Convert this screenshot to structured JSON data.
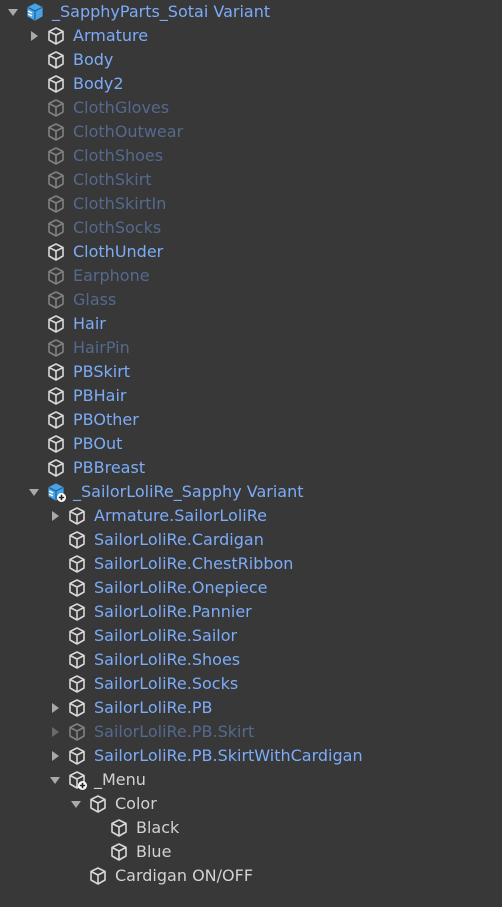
{
  "colors": {
    "background": "#383838",
    "prefab_text": "#7cacf8",
    "object_text": "#d2d2d2",
    "inactive_text": "#55698f",
    "prefab_root_icon": "#4aa3e6"
  },
  "hierarchy": {
    "rows": [
      {
        "label": "_SapphyParts_Sotai Variant",
        "depth": 0,
        "arrow": "down",
        "icon": "prefab-variant-root-icon",
        "style": "blue"
      },
      {
        "label": "Armature",
        "depth": 1,
        "arrow": "right",
        "icon": "cube-icon",
        "style": "blue"
      },
      {
        "label": "Body",
        "depth": 1,
        "arrow": "",
        "icon": "cube-icon",
        "style": "blue"
      },
      {
        "label": "Body2",
        "depth": 1,
        "arrow": "",
        "icon": "cube-icon",
        "style": "blue"
      },
      {
        "label": "ClothGloves",
        "depth": 1,
        "arrow": "",
        "icon": "cube-icon",
        "style": "dim"
      },
      {
        "label": "ClothOutwear",
        "depth": 1,
        "arrow": "",
        "icon": "cube-icon",
        "style": "dim"
      },
      {
        "label": "ClothShoes",
        "depth": 1,
        "arrow": "",
        "icon": "cube-icon",
        "style": "dim"
      },
      {
        "label": "ClothSkirt",
        "depth": 1,
        "arrow": "",
        "icon": "cube-icon",
        "style": "dim"
      },
      {
        "label": "ClothSkirtIn",
        "depth": 1,
        "arrow": "",
        "icon": "cube-icon",
        "style": "dim"
      },
      {
        "label": "ClothSocks",
        "depth": 1,
        "arrow": "",
        "icon": "cube-icon",
        "style": "dim"
      },
      {
        "label": "ClothUnder",
        "depth": 1,
        "arrow": "",
        "icon": "cube-icon",
        "style": "blue"
      },
      {
        "label": "Earphone",
        "depth": 1,
        "arrow": "",
        "icon": "cube-icon",
        "style": "dim"
      },
      {
        "label": "Glass",
        "depth": 1,
        "arrow": "",
        "icon": "cube-icon",
        "style": "dim"
      },
      {
        "label": "Hair",
        "depth": 1,
        "arrow": "",
        "icon": "cube-icon",
        "style": "blue"
      },
      {
        "label": "HairPin",
        "depth": 1,
        "arrow": "",
        "icon": "cube-icon",
        "style": "dim"
      },
      {
        "label": "PBSkirt",
        "depth": 1,
        "arrow": "",
        "icon": "cube-icon",
        "style": "blue"
      },
      {
        "label": "PBHair",
        "depth": 1,
        "arrow": "",
        "icon": "cube-icon",
        "style": "blue"
      },
      {
        "label": "PBOther",
        "depth": 1,
        "arrow": "",
        "icon": "cube-icon",
        "style": "blue"
      },
      {
        "label": "PBOut",
        "depth": 1,
        "arrow": "",
        "icon": "cube-icon",
        "style": "blue"
      },
      {
        "label": "PBBreast",
        "depth": 1,
        "arrow": "",
        "icon": "cube-icon",
        "style": "blue"
      },
      {
        "label": "_SailorLoliRe_Sapphy Variant",
        "depth": 1,
        "arrow": "down",
        "icon": "prefab-variant-added-icon",
        "style": "blue"
      },
      {
        "label": "Armature.SailorLoliRe",
        "depth": 2,
        "arrow": "right",
        "icon": "cube-icon",
        "style": "blue"
      },
      {
        "label": "SailorLoliRe.Cardigan",
        "depth": 2,
        "arrow": "",
        "icon": "cube-icon",
        "style": "blue"
      },
      {
        "label": "SailorLoliRe.ChestRibbon",
        "depth": 2,
        "arrow": "",
        "icon": "cube-icon",
        "style": "blue"
      },
      {
        "label": "SailorLoliRe.Onepiece",
        "depth": 2,
        "arrow": "",
        "icon": "cube-icon",
        "style": "blue"
      },
      {
        "label": "SailorLoliRe.Pannier",
        "depth": 2,
        "arrow": "",
        "icon": "cube-icon",
        "style": "blue"
      },
      {
        "label": "SailorLoliRe.Sailor",
        "depth": 2,
        "arrow": "",
        "icon": "cube-icon",
        "style": "blue"
      },
      {
        "label": "SailorLoliRe.Shoes",
        "depth": 2,
        "arrow": "",
        "icon": "cube-icon",
        "style": "blue"
      },
      {
        "label": "SailorLoliRe.Socks",
        "depth": 2,
        "arrow": "",
        "icon": "cube-icon",
        "style": "blue"
      },
      {
        "label": "SailorLoliRe.PB",
        "depth": 2,
        "arrow": "right",
        "icon": "cube-icon",
        "style": "blue"
      },
      {
        "label": "SailorLoliRe.PB.Skirt",
        "depth": 2,
        "arrow": "right",
        "icon": "cube-icon",
        "style": "dim"
      },
      {
        "label": "SailorLoliRe.PB.SkirtWithCardigan",
        "depth": 2,
        "arrow": "right",
        "icon": "cube-icon",
        "style": "blue"
      },
      {
        "label": "_Menu",
        "depth": 2,
        "arrow": "down",
        "icon": "cube-added-icon",
        "style": "white"
      },
      {
        "label": "Color",
        "depth": 3,
        "arrow": "down",
        "icon": "cube-icon",
        "style": "white"
      },
      {
        "label": "Black",
        "depth": 4,
        "arrow": "",
        "icon": "cube-icon",
        "style": "white"
      },
      {
        "label": "Blue",
        "depth": 4,
        "arrow": "",
        "icon": "cube-icon",
        "style": "white"
      },
      {
        "label": "Cardigan ON/OFF",
        "depth": 3,
        "arrow": "",
        "icon": "cube-icon",
        "style": "white"
      }
    ]
  }
}
